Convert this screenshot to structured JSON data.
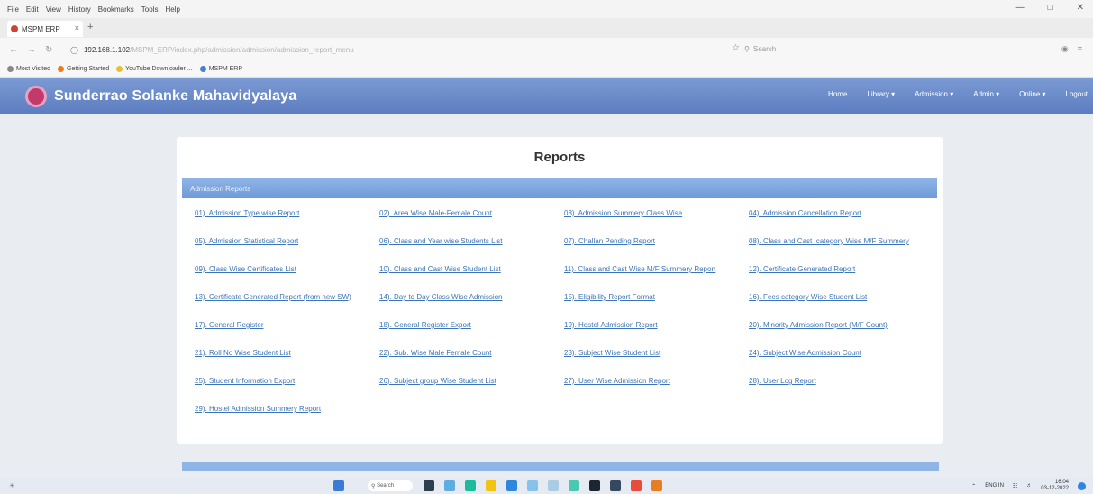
{
  "browser": {
    "menu": [
      "File",
      "Edit",
      "View",
      "History",
      "Bookmarks",
      "Tools",
      "Help"
    ],
    "tab_title": "MSPM ERP",
    "url_host": "192.168.1.102",
    "url_rest": "/MSPM_ERP/index.php/admission/admission/admission_report_menu",
    "search_placeholder": "Search",
    "bookmarks": [
      "Most Visited",
      "Getting Started",
      "YouTube Downloader ...",
      "MSPM ERP"
    ]
  },
  "app": {
    "brand": "Sunderrao Solanke Mahavidyalaya",
    "nav": [
      "Home",
      "Library ▾",
      "Admission ▾",
      "Admin ▾",
      "Online ▾",
      "Logout"
    ]
  },
  "panel": {
    "title": "Reports",
    "section": "Admission Reports",
    "reports": [
      "01). Admission Type wise Report",
      "02). Area Wise Male-Female Count",
      "03). Admission Summery Class Wise",
      "04). Admission Cancellation Report",
      "05). Admission Statistical Report",
      "06). Class and Year wise Students List",
      "07). Challan Pending Report",
      "08). Class and Cast_category Wise M/F Summery",
      "09). Class Wise Certificates List",
      "10). Class and Cast Wise Student List",
      "11). Class and Cast Wise M/F Summery Report",
      "12). Certificate Generated Report",
      "13). Certificate Generated Report (from new SW)",
      "14). Day to Day Class Wise Admission",
      "15). Eligibility Report Format",
      "16). Fees category Wise Student List",
      "17). General Register",
      "18). General Register Export",
      "19). Hostel Admission Report",
      "20). Minority Admission Report (M/F Count)",
      "21). Roll No Wise Student List",
      "22). Sub. Wise Male Female Count",
      "23). Subject Wise Student List",
      "24). Subject Wise Admission Count",
      "25). Student Information Export",
      "26). Subject group Wise Student List",
      "27). User Wise Admission Report",
      "28). User Log Report",
      "29). Hostel Admission Summery Report"
    ]
  },
  "taskbar": {
    "search": "Search",
    "lang": "ENG IN",
    "time": "16:04",
    "date": "03-12-2022"
  }
}
